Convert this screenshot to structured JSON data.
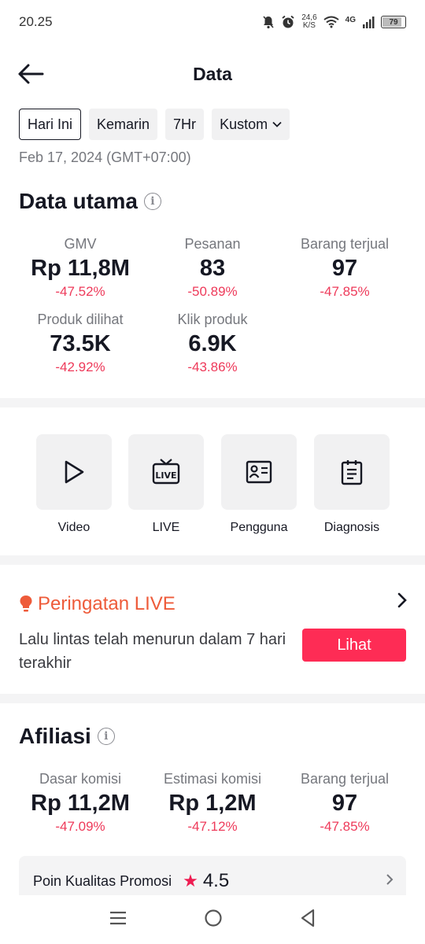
{
  "status": {
    "time": "20.25",
    "speed_top": "24,6",
    "speed_bottom": "K/S",
    "network": "4G",
    "battery": "79"
  },
  "header": {
    "title": "Data"
  },
  "filters": [
    {
      "label": "Hari Ini"
    },
    {
      "label": "Kemarin"
    },
    {
      "label": "7Hr"
    },
    {
      "label": "Kustom"
    }
  ],
  "date_line": "Feb 17, 2024 (GMT+07:00)",
  "main_data": {
    "title": "Data utama",
    "metrics": [
      {
        "label": "GMV",
        "value": "Rp 11,8M",
        "change": "-47.52%"
      },
      {
        "label": "Pesanan",
        "value": "83",
        "change": "-50.89%"
      },
      {
        "label": "Barang terjual",
        "value": "97",
        "change": "-47.85%"
      },
      {
        "label": "Produk dilihat",
        "value": "73.5K",
        "change": "-42.92%"
      },
      {
        "label": "Klik produk",
        "value": "6.9K",
        "change": "-43.86%"
      }
    ]
  },
  "tools": [
    {
      "label": "Video",
      "icon": "play-icon"
    },
    {
      "label": "LIVE",
      "icon": "live-tv-icon"
    },
    {
      "label": "Pengguna",
      "icon": "user-card-icon"
    },
    {
      "label": "Diagnosis",
      "icon": "clipboard-icon"
    }
  ],
  "alert": {
    "title": "Peringatan LIVE",
    "text": "Lalu lintas telah menurun dalam 7 hari terakhir",
    "button": "Lihat",
    "color": "#ee5b3a"
  },
  "affiliate": {
    "title": "Afiliasi",
    "metrics": [
      {
        "label": "Dasar komisi",
        "value": "Rp 11,2M",
        "change": "-47.09%"
      },
      {
        "label": "Estimasi komisi",
        "value": "Rp 1,2M",
        "change": "-47.12%"
      },
      {
        "label": "Barang terjual",
        "value": "97",
        "change": "-47.85%"
      }
    ]
  },
  "promo": {
    "label": "Poin Kualitas Promosi",
    "score": "4.5"
  },
  "colors": {
    "accent": "#fe2c55",
    "negative": "#ee3a5a"
  }
}
